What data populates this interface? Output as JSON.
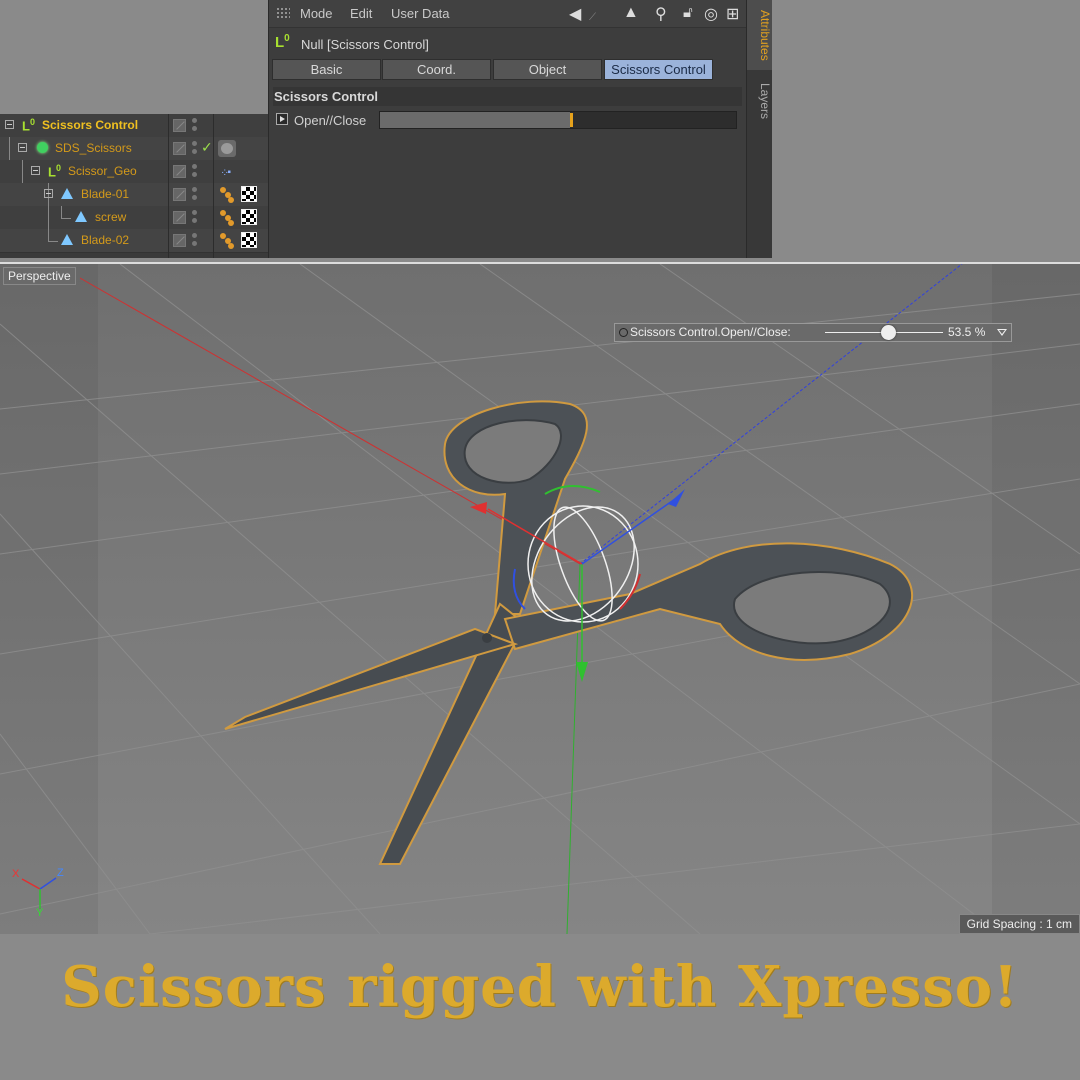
{
  "attributes": {
    "menu": [
      "Mode",
      "Edit",
      "User Data"
    ],
    "object_title": "Null [Scissors Control]",
    "tabs": [
      "Basic",
      "Coord.",
      "Object",
      "Scissors Control"
    ],
    "active_tab": "Scissors Control",
    "section_title": "Scissors Control",
    "param_label": "Open//Close",
    "param_value_fraction": 0.535,
    "side_tabs": [
      "Attributes",
      "Layers"
    ]
  },
  "object_manager": {
    "items": [
      {
        "name": "Scissors Control",
        "icon": "null-icon",
        "depth": 0
      },
      {
        "name": "SDS_Scissors",
        "icon": "subdivision-surface-icon",
        "depth": 1
      },
      {
        "name": "Scissor_Geo",
        "icon": "null-icon",
        "depth": 2
      },
      {
        "name": "Blade-01",
        "icon": "polygon-object-icon",
        "depth": 3
      },
      {
        "name": "screw",
        "icon": "polygon-object-icon",
        "depth": 4
      },
      {
        "name": "Blade-02",
        "icon": "polygon-object-icon",
        "depth": 3
      }
    ]
  },
  "viewport": {
    "label": "Perspective",
    "grid_spacing": "Grid Spacing : 1 cm",
    "hud_label": "Scissors Control.Open//Close:",
    "hud_value": "53.5 %",
    "hud_fraction": 0.535,
    "axes": {
      "x": "X",
      "y": "Y",
      "z": "Z"
    }
  },
  "caption": "Scissors rigged with Xpresso!",
  "colors": {
    "accent_orange": "#e6a21c",
    "active_tab": "#9bb3da",
    "caption": "#dcaa2c",
    "x_axis": "#e03030",
    "y_axis": "#30c030",
    "z_axis": "#3050e0"
  }
}
